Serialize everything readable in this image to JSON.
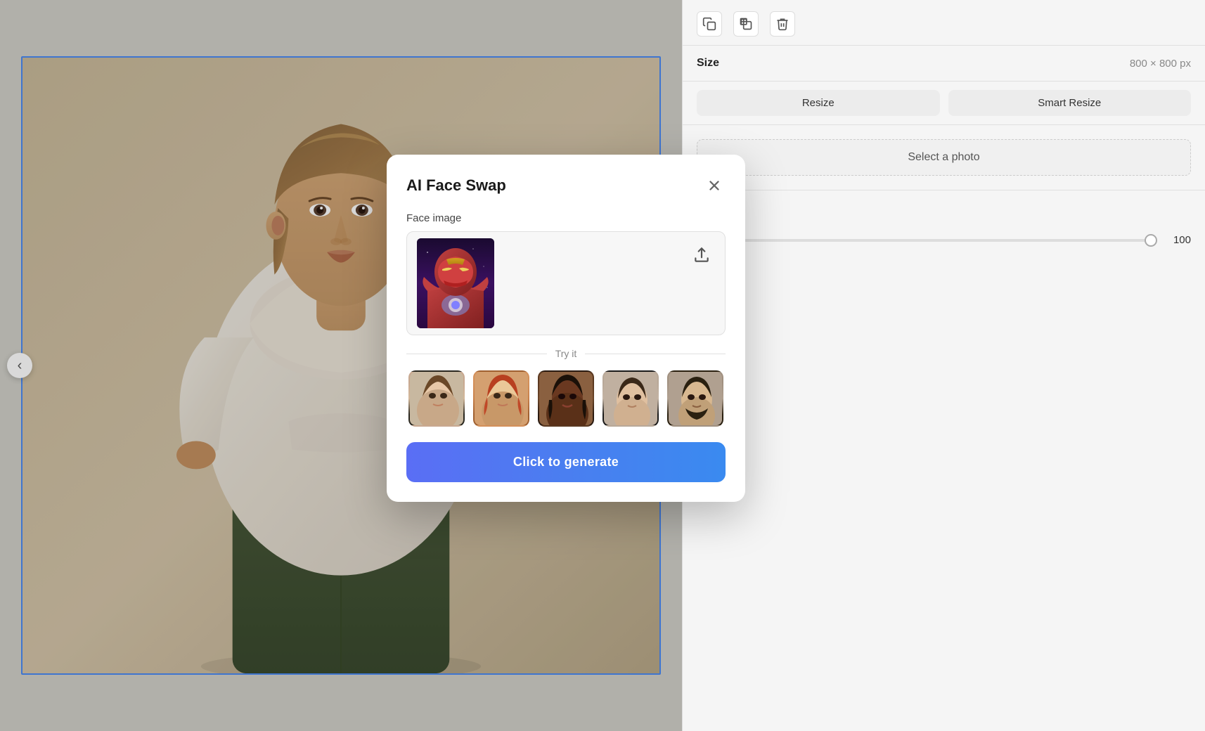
{
  "canvas": {
    "border_color": "#4a8af4"
  },
  "right_panel": {
    "size_label": "Size",
    "size_value": "800 × 800 px",
    "resize_btn": "Resize",
    "smart_resize_btn": "Smart Resize",
    "select_photo_label": "Select a photo",
    "slider_value": "100"
  },
  "modal": {
    "title": "AI Face Swap",
    "close_label": "×",
    "face_image_label": "Face image",
    "upload_icon": "↑",
    "try_it_label": "Try it",
    "generate_btn_label": "Click to generate",
    "sample_faces": [
      {
        "id": 1,
        "alt": "Woman with brown hair"
      },
      {
        "id": 2,
        "alt": "Woman with red hair"
      },
      {
        "id": 3,
        "alt": "Dark-skinned woman"
      },
      {
        "id": 4,
        "alt": "Young man short hair"
      },
      {
        "id": 5,
        "alt": "Man with beard"
      }
    ]
  },
  "toolbar": {
    "copy_style_icon": "copy-style",
    "copy_icon": "copy",
    "delete_icon": "delete"
  },
  "left_nav": {
    "arrow": "‹"
  }
}
